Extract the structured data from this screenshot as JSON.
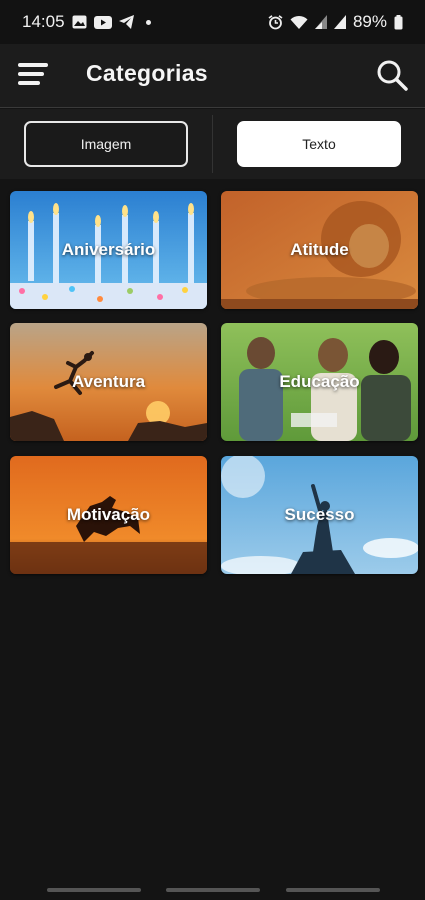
{
  "status_bar": {
    "time": "14:05",
    "battery": "89%",
    "left_icons": [
      "gallery-icon",
      "youtube-icon",
      "telegram-icon",
      "dot-icon"
    ],
    "right_icons": [
      "alarm-icon",
      "wifi-icon",
      "signal-icon",
      "signal-icon",
      "battery-icon"
    ]
  },
  "app_bar": {
    "title": "Categorias",
    "menu_icon": "menu-icon",
    "search_icon": "search-icon"
  },
  "toggle": {
    "image_label": "Imagem",
    "text_label": "Texto",
    "selected": "Texto"
  },
  "categories": [
    {
      "label": "Aniversário"
    },
    {
      "label": "Atitude"
    },
    {
      "label": "Aventura"
    },
    {
      "label": "Educação"
    },
    {
      "label": "Motivação"
    },
    {
      "label": "Sucesso"
    }
  ],
  "colors": {
    "background": "#141414",
    "app_bar": "#1c1c1c",
    "selected_toggle": "#ffffff"
  }
}
